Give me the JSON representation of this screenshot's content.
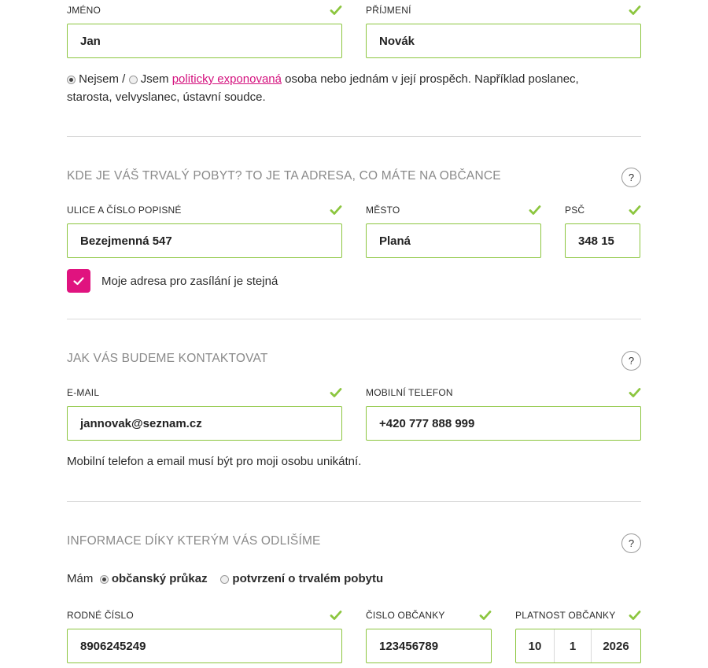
{
  "personal": {
    "first_name_label": "JMÉNO",
    "first_name_value": "Jan",
    "last_name_label": "PŘÍJMENÍ",
    "last_name_value": "Novák",
    "pep_option_no": "Nejsem /",
    "pep_option_yes": "Jsem",
    "pep_link": "politicky exponovaná",
    "pep_text_1": "osoba nebo jednám v její prospěch. Například poslanec,",
    "pep_text_2": "starosta, velvyslanec, ústavní soudce."
  },
  "address": {
    "title": "KDE JE VÁŠ TRVALÝ POBYT? TO JE TA ADRESA, CO MÁTE NA OBČANCE",
    "help": "?",
    "street_label": "ULICE A ČÍSLO POPISNÉ",
    "street_value": "Bezejmenná 547",
    "city_label": "MĚSTO",
    "city_value": "Planá",
    "zip_label": "PSČ",
    "zip_value": "348 15",
    "same_mailing_label": "Moje adresa pro zasílání je stejná"
  },
  "contact": {
    "title": "JAK VÁS BUDEME KONTAKTOVAT",
    "help": "?",
    "email_label": "E-MAIL",
    "email_value": "jannovak@seznam.cz",
    "phone_label": "MOBILNÍ TELEFON",
    "phone_value": "+420 777 888 999",
    "note": "Mobilní telefon a email musí být pro moji osobu unikátní."
  },
  "identity": {
    "title": "INFORMACE DÍKY KTERÝM VÁS ODLIŠÍME",
    "help": "?",
    "have_label": "Mám",
    "doc_option_1": "občanský průkaz",
    "doc_option_2": "potvrzení o trvalém pobytu",
    "birth_number_label": "RODNÉ ČÍSLO",
    "birth_number_value": "8906245249",
    "id_number_label": "ČISLO OBČANKY",
    "id_number_value": "123456789",
    "validity_label": "PLATNOST OBČANKY",
    "validity_day": "10",
    "validity_month": "1",
    "validity_year": "2026"
  },
  "colors": {
    "valid_green": "#8cc63f",
    "accent_pink": "#e0137f",
    "link_pink": "#d4127e"
  }
}
